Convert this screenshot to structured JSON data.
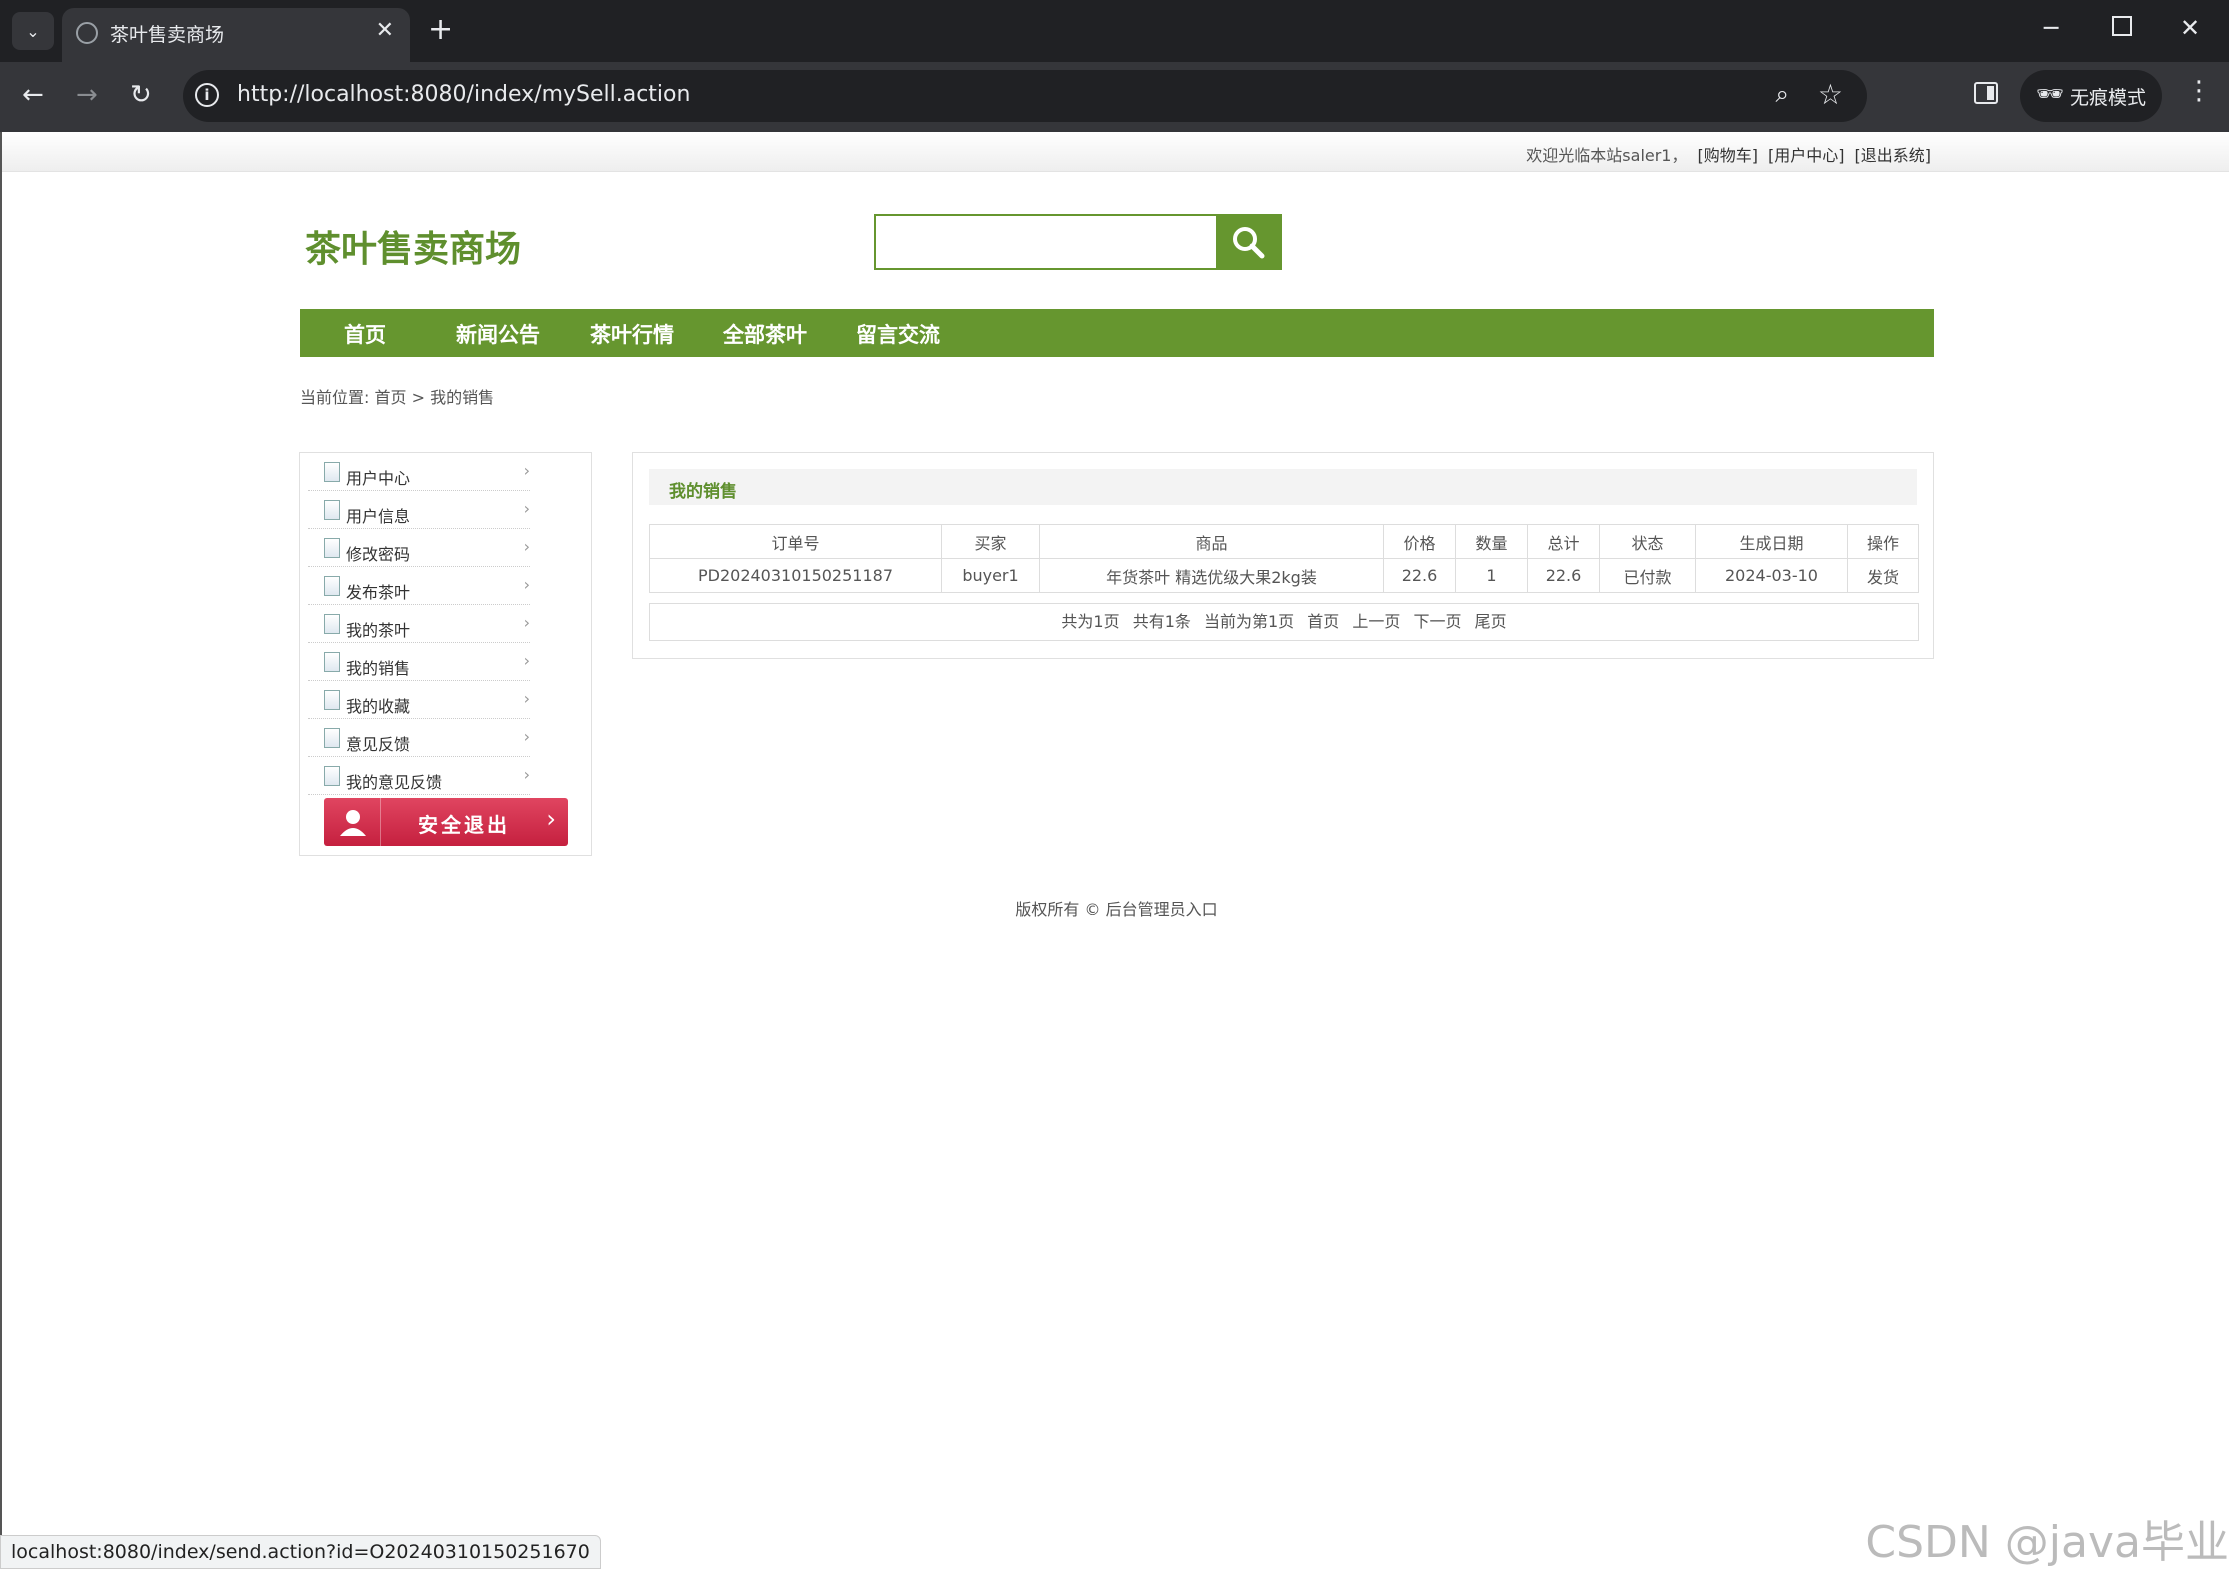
{
  "browser": {
    "tab_title": "茶叶售卖商场",
    "url": "http://localhost:8080/index/mySell.action",
    "incognito_label": "无痕模式",
    "status_url": "localhost:8080/index/send.action?id=O20240310150251670"
  },
  "topbar": {
    "welcome": "欢迎光临本站saler1，",
    "links": [
      "[购物车]",
      "[用户中心]",
      "[退出系统]"
    ]
  },
  "site": {
    "logo": "茶叶售卖商场"
  },
  "search": {
    "placeholder": ""
  },
  "nav": [
    "首页",
    "新闻公告",
    "茶叶行情",
    "全部茶叶",
    "留言交流"
  ],
  "breadcrumb": {
    "prefix": "当前位置:",
    "home": "首页",
    "sep": ">",
    "current": "我的销售"
  },
  "sidebar": {
    "items": [
      "用户中心",
      "用户信息",
      "修改密码",
      "发布茶叶",
      "我的茶叶",
      "我的销售",
      "我的收藏",
      "意见反馈",
      "我的意见反馈"
    ],
    "logout": "安全退出"
  },
  "panel": {
    "title": "我的销售",
    "columns": [
      "订单号",
      "买家",
      "商品",
      "价格",
      "数量",
      "总计",
      "状态",
      "生成日期",
      "操作"
    ],
    "rows": [
      [
        "PD20240310150251187",
        "buyer1",
        "年货茶叶 精选优级大果2kg装",
        "22.6",
        "1",
        "22.6",
        "已付款",
        "2024-03-10",
        "发货"
      ]
    ],
    "pager": [
      "共为1页",
      "共有1条",
      "当前为第1页",
      "首页",
      "上一页",
      "下一页",
      "尾页"
    ]
  },
  "footer": "版权所有 © 后台管理员入口",
  "watermark": "CSDN @java毕业",
  "colors": {
    "brand_green": "#66962f",
    "logout_red": "#d0304c"
  }
}
